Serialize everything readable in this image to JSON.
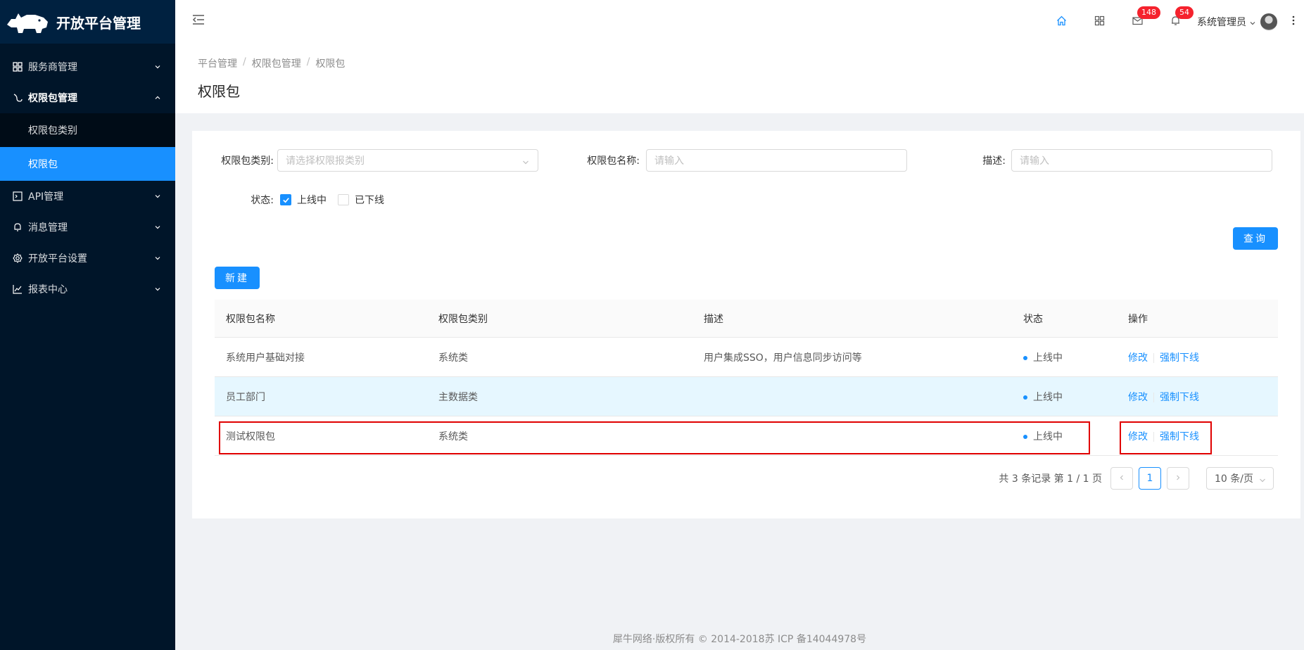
{
  "app": {
    "title": "开放平台管理"
  },
  "sidebar": {
    "items": [
      {
        "label": "服务商管理"
      },
      {
        "label": "权限包管理"
      },
      {
        "label": "API管理"
      },
      {
        "label": "消息管理"
      },
      {
        "label": "开放平台设置"
      },
      {
        "label": "报表中心"
      }
    ],
    "sub_items": [
      {
        "label": "权限包类别"
      },
      {
        "label": "权限包"
      }
    ]
  },
  "header": {
    "mail_count": "148",
    "notify_count": "54",
    "user_name": "系统管理员"
  },
  "breadcrumb": [
    "平台管理",
    "权限包管理",
    "权限包"
  ],
  "page_title": "权限包",
  "filters": {
    "category_label": "权限包类别:",
    "category_placeholder": "请选择权限报类别",
    "name_label": "权限包名称:",
    "name_placeholder": "请输入",
    "desc_label": "描述:",
    "desc_placeholder": "请输入",
    "status_label": "状态:",
    "status_online": "上线中",
    "status_offline": "已下线",
    "online_checked": true,
    "offline_checked": false
  },
  "buttons": {
    "query": "查询",
    "create": "新建"
  },
  "table": {
    "headers": [
      "权限包名称",
      "权限包类别",
      "描述",
      "状态",
      "操作"
    ],
    "rows": [
      {
        "name": "系统用户基础对接",
        "category": "系统类",
        "desc": "用户集成SSO，用户信息同步访问等",
        "status": "上线中",
        "edit": "修改",
        "offline": "强制下线"
      },
      {
        "name": "员工部门",
        "category": "主数据类",
        "desc": "",
        "status": "上线中",
        "edit": "修改",
        "offline": "强制下线"
      },
      {
        "name": "测试权限包",
        "category": "系统类",
        "desc": "",
        "status": "上线中",
        "edit": "修改",
        "offline": "强制下线"
      }
    ]
  },
  "pagination": {
    "total_text": "共 3 条记录 第 1 / 1 页",
    "current_page": "1",
    "page_size": "10 条/页"
  },
  "footer": {
    "text": "犀牛网络·版权所有 © 2014-2018苏 ICP 备14044978号"
  },
  "colors": {
    "primary": "#1890ff",
    "sidebar_bg": "#001529",
    "highlight_box": "#e00000",
    "badge": "#f5222d"
  }
}
